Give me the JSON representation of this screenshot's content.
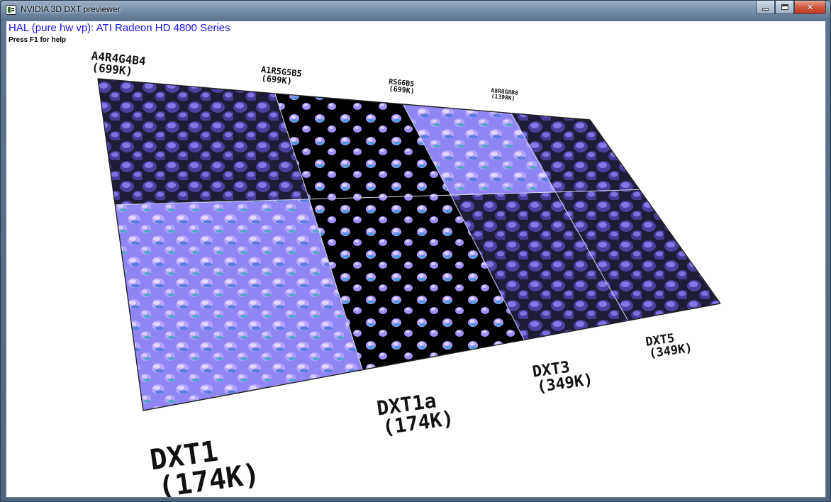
{
  "window": {
    "title": "NVIDIA 3D DXT previewer",
    "icon": "app-icon",
    "buttons": [
      "minimize-icon",
      "maximize-icon",
      "close-icon"
    ],
    "close_glyph": "✕"
  },
  "overlay": {
    "device": "HAL (pure hw vp): ATI Radeon HD 4800 Series",
    "help": "Press F1 for help",
    "device_color": "#1515e8"
  },
  "tiles_top": [
    {
      "format": "A4R4G4B4",
      "size": "(699K)",
      "style": "dark-bumps"
    },
    {
      "format": "A1R5G5B5",
      "size": "(699K)",
      "style": "alpha-cutout"
    },
    {
      "format": "R5G6B5",
      "size": "(699K)",
      "style": "bright-normal"
    },
    {
      "format": "A8R8G8B8",
      "size": "(1398K)",
      "style": "dark-bumps"
    }
  ],
  "tiles_bottom": [
    {
      "format": "DXT1",
      "size": "(174K)",
      "style": "bright-normal"
    },
    {
      "format": "DXT1a",
      "size": "(174K)",
      "style": "alpha-cutout"
    },
    {
      "format": "DXT3",
      "size": "(349K)",
      "style": "dark-bumps"
    },
    {
      "format": "DXT5",
      "size": "(349K)",
      "style": "dark-bumps"
    }
  ],
  "colors": {
    "normal_base": "#8a82f0",
    "bump_highlight": "#c9b8ff",
    "dark_base": "#1c1a33",
    "cutout_bg": "#000000"
  }
}
